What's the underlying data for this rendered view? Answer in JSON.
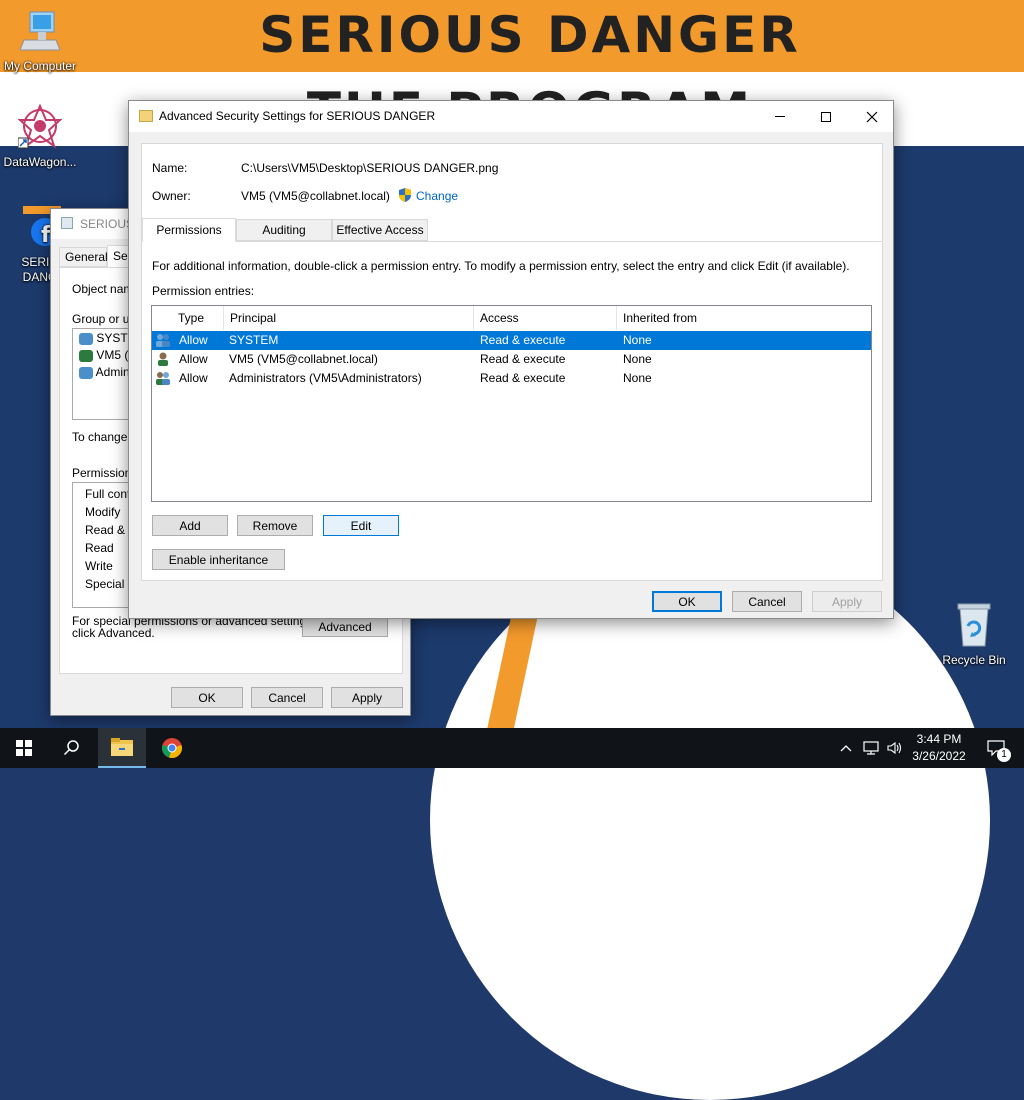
{
  "wallpaper": {
    "headline": "SERIOUS DANGER",
    "subline": "THE PROGRAM"
  },
  "desktop": {
    "icons": [
      {
        "label": "My Computer",
        "icon": "computer-icon"
      },
      {
        "label": "DataWagon...",
        "icon": "datawagon-icon"
      },
      {
        "label": "SERIOUS DANGER",
        "icon": "image-file-icon"
      },
      {
        "label": "Recycle Bin",
        "icon": "recycle-bin-icon"
      }
    ]
  },
  "props_window": {
    "title": "SERIOUS DANGER.png Properties",
    "title_visible": "SERIOUS",
    "tabs": [
      "General",
      "Security"
    ],
    "tab_visible": [
      "General",
      "Sec"
    ],
    "object_name_label": "Object name",
    "group_label": "Group or use",
    "group_items": [
      "SYSTEM",
      "VM5 (V",
      "Adminis"
    ],
    "change_text": "To change p",
    "permissions_label": "Permissions f",
    "permission_items": [
      "Full contro",
      "Modify",
      "Read & ex",
      "Read",
      "Write",
      "Special pe"
    ],
    "special_text_1": "For special permissions or advanced settings,",
    "special_text_2": "click Advanced.",
    "advanced_button": "Advanced",
    "ok": "OK",
    "cancel": "Cancel",
    "apply": "Apply"
  },
  "dialog": {
    "title": "Advanced Security Settings for SERIOUS DANGER",
    "name_label": "Name:",
    "name_value": "C:\\Users\\VM5\\Desktop\\SERIOUS DANGER.png",
    "owner_label": "Owner:",
    "owner_value": "VM5 (VM5@collabnet.local)",
    "change_link": "Change",
    "tabs": [
      "Permissions",
      "Auditing",
      "Effective Access"
    ],
    "info_text": "For additional information, double-click a permission entry. To modify a permission entry, select the entry and click Edit (if available).",
    "entries_label": "Permission entries:",
    "columns": [
      "Type",
      "Principal",
      "Access",
      "Inherited from"
    ],
    "entries": [
      {
        "type": "Allow",
        "principal": "SYSTEM",
        "access": "Read & execute",
        "inherited": "None",
        "icon": "group-users-icon"
      },
      {
        "type": "Allow",
        "principal": "VM5 (VM5@collabnet.local)",
        "access": "Read & execute",
        "inherited": "None",
        "icon": "user-icon"
      },
      {
        "type": "Allow",
        "principal": "Administrators (VM5\\Administrators)",
        "access": "Read & execute",
        "inherited": "None",
        "icon": "group-users-icon"
      }
    ],
    "selected_index": 0,
    "add_button": "Add",
    "remove_button": "Remove",
    "edit_button": "Edit",
    "inheritance_button": "Enable inheritance",
    "ok": "OK",
    "cancel": "Cancel",
    "apply": "Apply"
  },
  "taskbar": {
    "time": "3:44 PM",
    "date": "3/26/2022",
    "notification_count": "1"
  },
  "colors": {
    "accent": "#0078d7",
    "wallpaper_orange": "#f39a2c",
    "wallpaper_blue": "#1d3a6c",
    "taskbar": "#101418"
  }
}
